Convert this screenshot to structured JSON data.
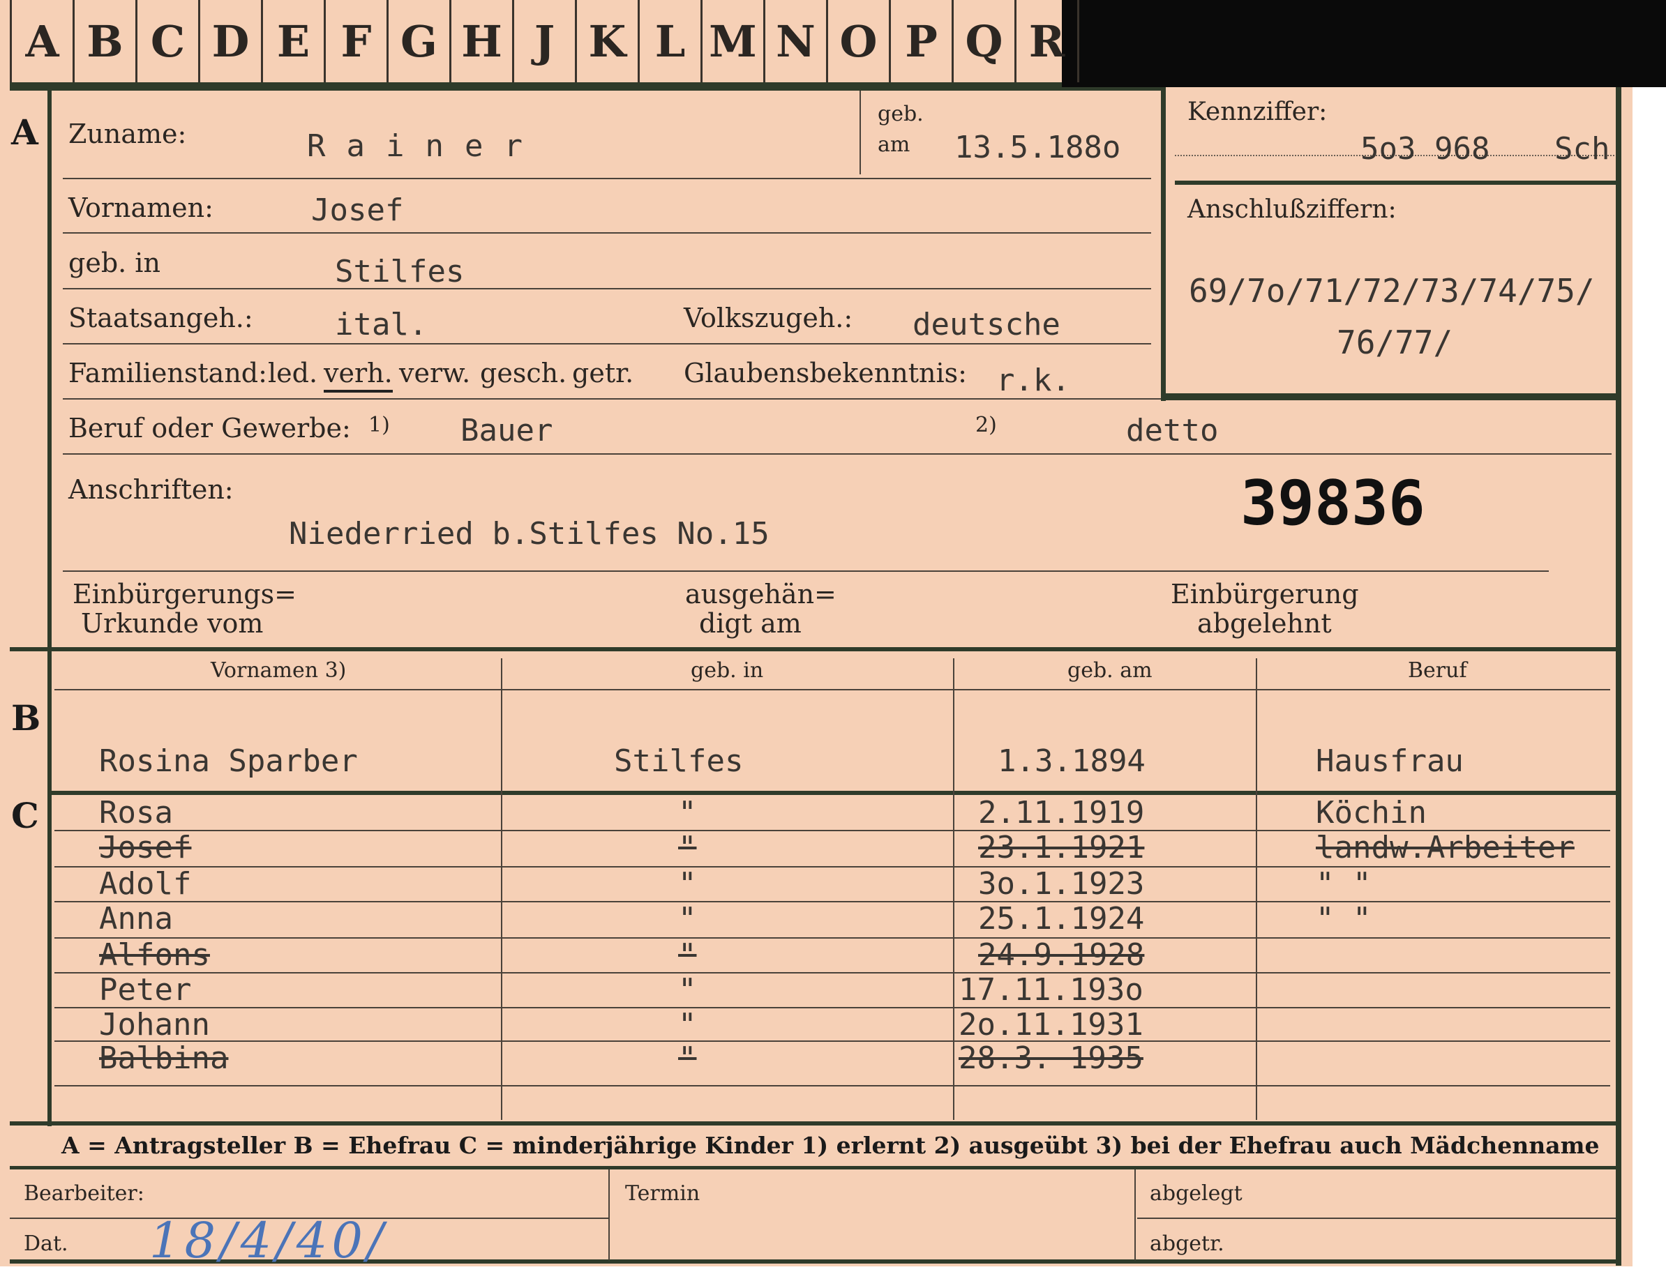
{
  "tabs": [
    "A",
    "B",
    "C",
    "D",
    "E",
    "F",
    "G",
    "H",
    "J",
    "K",
    "L",
    "M",
    "N",
    "O",
    "P",
    "Q",
    "R"
  ],
  "section_a": {
    "marker": "A",
    "zuname_label": "Zuname:",
    "zuname": "Rainer",
    "geb_label1": "geb.",
    "geb_label2": "am",
    "geb_am": "13.5.188o",
    "vornamen_label": "Vornamen:",
    "vornamen": "Josef",
    "geb_in_label": "geb. in",
    "geb_in": "Stilfes",
    "staatsangeh_label": "Staatsangeh.:",
    "staatsangeh": "ital.",
    "volkszugeh_label": "Volkszugeh.:",
    "volkszugeh": "deutsche",
    "familienstand_label": "Familienstand:",
    "familienstand_opts": [
      "led.",
      "verh.",
      "verw.",
      "gesch.",
      "getr."
    ],
    "glaubens_label": "Glaubensbekenntnis:",
    "glaubens": "r.k.",
    "beruf_label": "Beruf oder Gewerbe:",
    "beruf_mark1": "1)",
    "beruf1": "Bauer",
    "beruf_mark2": "2)",
    "beruf2": "detto",
    "anschriften_label": "Anschriften:",
    "anschrift": "Niederried b.Stilfes No.15",
    "stamp_number": "39836",
    "einb_urkunde_1": "Einbürgerungs=",
    "einb_urkunde_2": "Urkunde vom",
    "ausgeh_1": "ausgehän=",
    "ausgeh_2": "digt am",
    "einb_abgel_1": "Einbürgerung",
    "einb_abgel_2": "abgelehnt"
  },
  "kennziffer": {
    "label": "Kennziffer:",
    "value": "5o3 968",
    "suffix": "Sch",
    "anschluss_label": "Anschlußziffern:",
    "anschluss_line1": "69/7o/71/72/73/74/75/",
    "anschluss_line2": "76/77/"
  },
  "section_b": {
    "marker": "B",
    "headers": [
      "Vornamen 3)",
      "geb. in",
      "geb. am",
      "Beruf"
    ],
    "row": {
      "name": "Rosina  Sparber",
      "place": "Stilfes",
      "date": "1.3.1894",
      "job": "Hausfrau"
    }
  },
  "section_c": {
    "marker": "C",
    "children": [
      {
        "name": "Rosa",
        "place": "\"",
        "date": "2.11.1919",
        "job": "Köchin",
        "struck": false
      },
      {
        "name": "Josef",
        "place": "\"",
        "date": "23.1.1921",
        "job": "landw.Arbeiter",
        "struck": true
      },
      {
        "name": "Adolf",
        "place": "\"",
        "date": "3o.1.1923",
        "job": "\"       \"",
        "struck": false
      },
      {
        "name": "Anna",
        "place": "\"",
        "date": "25.1.1924",
        "job": "\"       \"",
        "struck": false
      },
      {
        "name": "Alfons",
        "place": "\"",
        "date": "24.9.1928",
        "job": "",
        "struck": true
      },
      {
        "name": "Peter",
        "place": "\"",
        "date": "17.11.193o",
        "job": "",
        "struck": false
      },
      {
        "name": "Johann",
        "place": "\"",
        "date": "2o.11.1931",
        "job": "",
        "struck": false
      },
      {
        "name": "Balbina",
        "place": "\"",
        "date": "28.3. 1935",
        "job": "",
        "struck": true
      }
    ]
  },
  "legend": "A = Antragsteller   B = Ehefrau   C = minderjährige Kinder   1) erlernt   2) ausgeübt   3) bei der Ehefrau auch Mädchenname",
  "footer": {
    "bearbeiter_label": "Bearbeiter:",
    "dat_label": "Dat.",
    "dat_value": "18/4/40/",
    "termin_label": "Termin",
    "abgelegt_label": "abgelegt",
    "abgetr_label": "abgetr."
  }
}
